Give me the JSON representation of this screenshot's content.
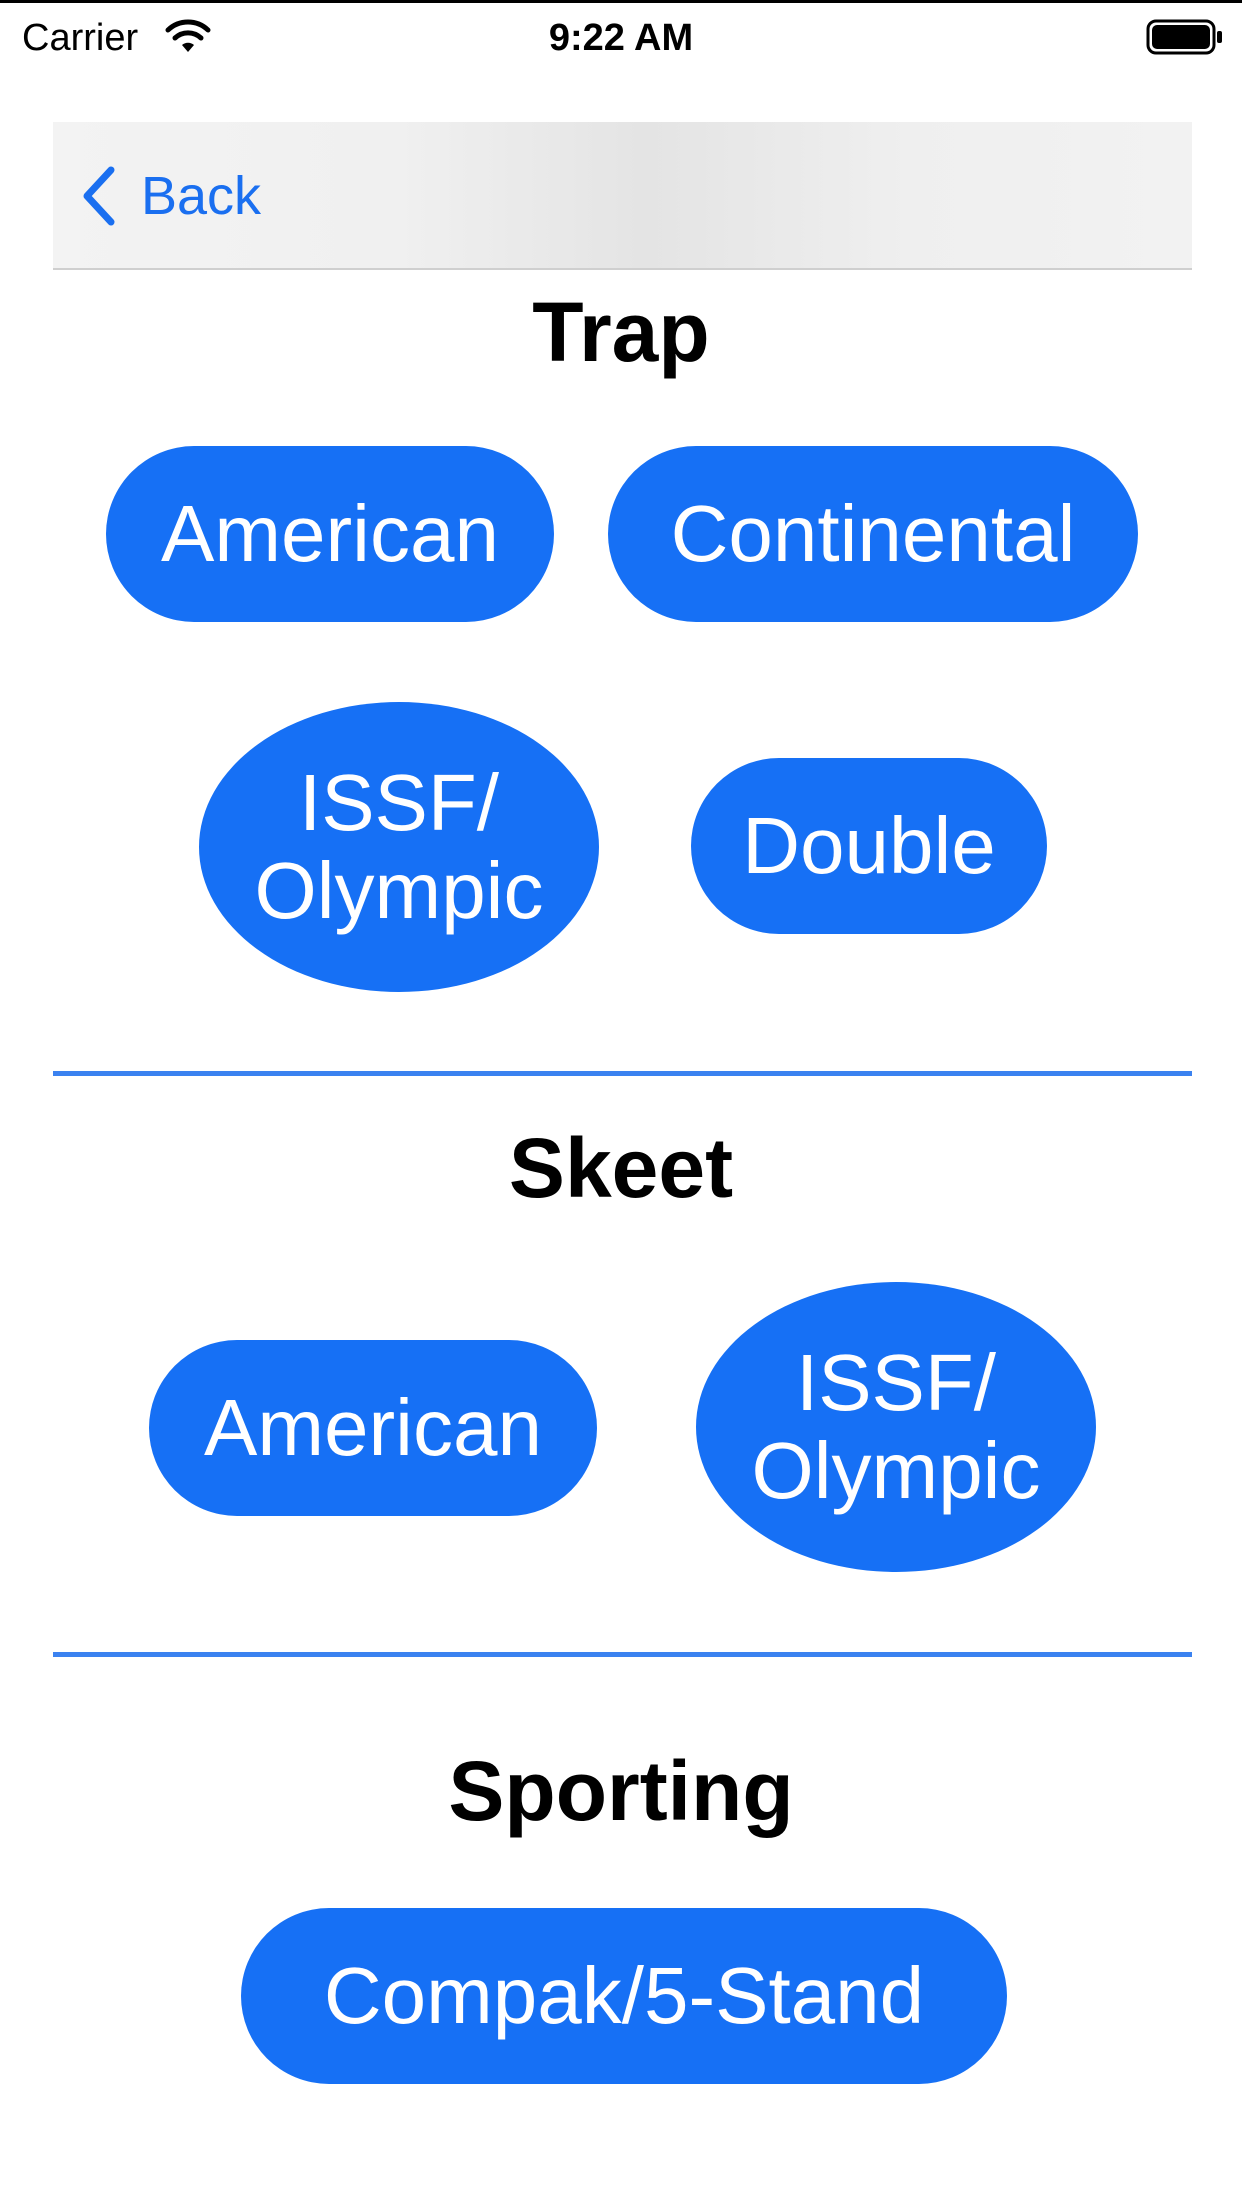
{
  "status_bar": {
    "carrier": "Carrier",
    "time": "9:22 AM",
    "wifi_icon": "wifi-icon",
    "battery_icon": "battery-icon"
  },
  "nav": {
    "back_label": "Back",
    "back_icon": "chevron-left-icon"
  },
  "sections": {
    "trap": {
      "title": "Trap",
      "buttons": [
        "American",
        "Continental",
        "ISSF/\nOlympic",
        "Double"
      ]
    },
    "skeet": {
      "title": "Skeet",
      "buttons": [
        "American",
        "ISSF/\nOlympic"
      ]
    },
    "sporting": {
      "title": "Sporting",
      "buttons": [
        "Compak/5-Stand"
      ]
    }
  },
  "colors": {
    "accent": "#1670f5",
    "divider": "#3b82f0",
    "back_text": "#1a6ff0"
  }
}
